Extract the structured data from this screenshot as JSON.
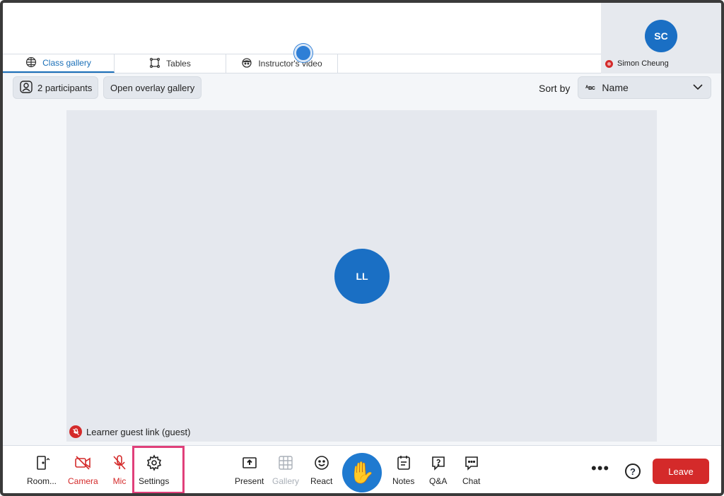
{
  "tabs": [
    {
      "label": "Class gallery",
      "icon": "grid-globe-icon",
      "active": true
    },
    {
      "label": "Tables",
      "icon": "tables-icon",
      "active": false
    },
    {
      "label": "Instructor's video",
      "icon": "face-icon",
      "active": false
    }
  ],
  "instructor": {
    "initials": "SC",
    "name": "Simon Cheung",
    "muted": true
  },
  "toolbar": {
    "participants_label": "2 participants",
    "overlay_label": "Open overlay gallery",
    "sort_label": "Sort by",
    "sort_value": "Name",
    "sort_icon_text": "ᴬʙᴄ"
  },
  "gallery": {
    "participant_initials": "LL",
    "guest_label": "Learner guest link (guest)"
  },
  "bottombar": {
    "room": "Room...",
    "camera": "Camera",
    "mic": "Mic",
    "settings": "Settings",
    "present": "Present",
    "gallery": "Gallery",
    "react": "React",
    "hand": "✋",
    "notes": "Notes",
    "qa": "Q&A",
    "chat": "Chat",
    "more": "•••",
    "help": "?",
    "leave": "Leave"
  },
  "colors": {
    "accent": "#1a6fb8",
    "avatar": "#1a6fc4",
    "danger": "#d42a2a",
    "highlight": "#e0407a"
  }
}
